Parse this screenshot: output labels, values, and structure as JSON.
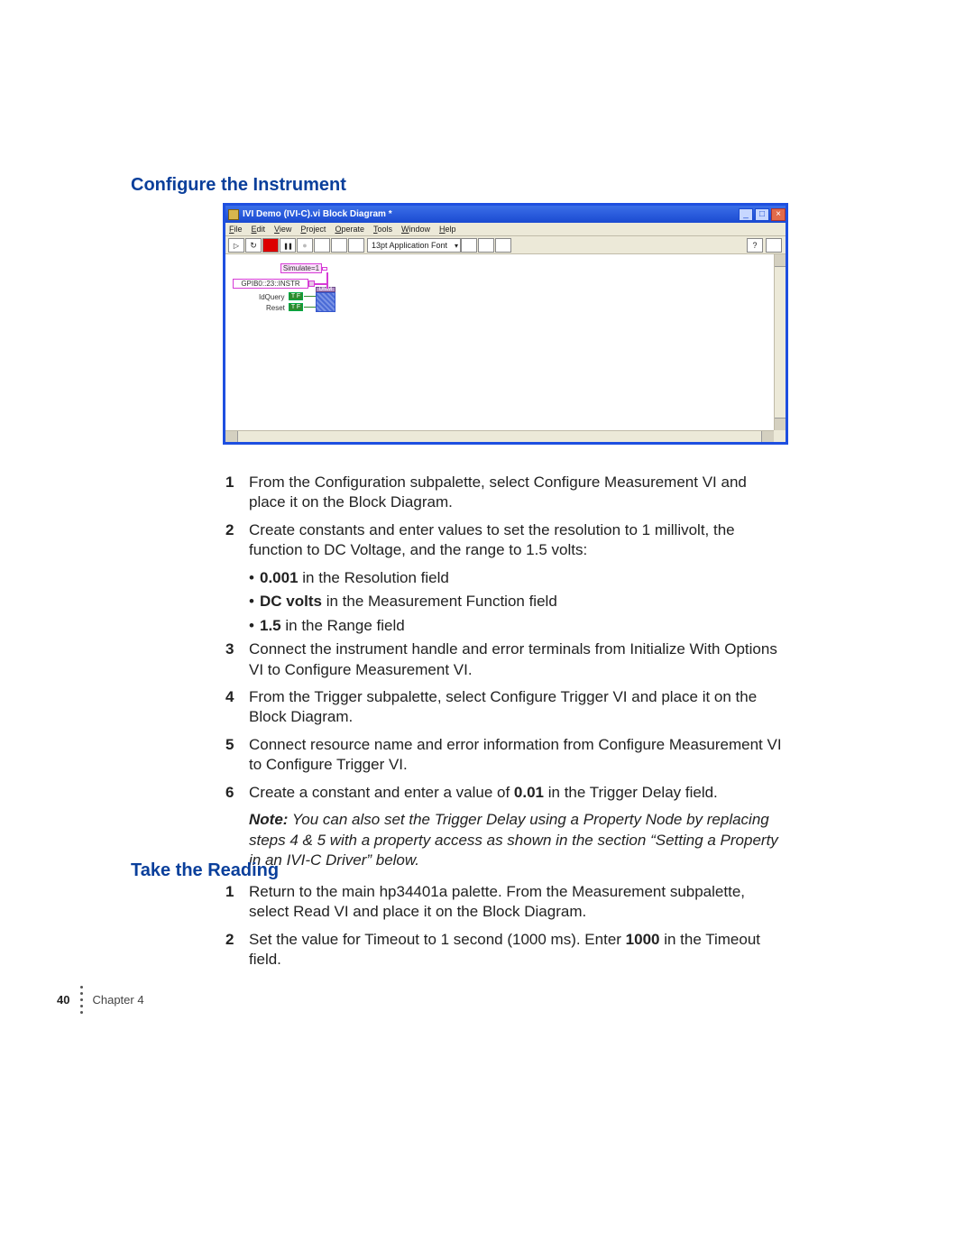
{
  "headings": {
    "configure": "Configure the Instrument",
    "take_reading": "Take the Reading"
  },
  "window": {
    "title": "IVI Demo (IVI-C).vi Block Diagram *",
    "menus": [
      "File",
      "Edit",
      "View",
      "Project",
      "Operate",
      "Tools",
      "Window",
      "Help"
    ],
    "font_label": "13pt Application Font",
    "nodes": {
      "simulate": "Simulate=1",
      "instr": "GPIB0::23::INSTR",
      "idquery": "IdQuery",
      "reset": "Reset",
      "bool_t": "T F",
      "vi_head": "DMM"
    }
  },
  "steps_configure": [
    {
      "n": "1",
      "t": "From the Configuration subpalette, select Configure Measurement VI and place it on the Block Diagram."
    },
    {
      "n": "2",
      "t": "Create constants and enter values to set the resolution to 1 millivolt, the function to DC Voltage, and the range to 1.5 volts:",
      "sub": [
        {
          "b": "0.001",
          "t": " in the Resolution field"
        },
        {
          "b": "DC volts",
          "t": " in the Measurement Function field"
        },
        {
          "b": "1.5",
          "t": " in the Range field"
        }
      ]
    },
    {
      "n": "3",
      "t": "Connect the instrument handle and error terminals from Initialize With Options VI to Configure Measurement VI."
    },
    {
      "n": "4",
      "t": "From the Trigger subpalette, select Configure Trigger VI and place it on the Block Diagram."
    },
    {
      "n": "5",
      "t": "Connect resource name and error information from Configure Measurement VI to Configure Trigger VI."
    },
    {
      "n": "6",
      "t_pre": "Create a constant and enter a value of ",
      "b": "0.01",
      "t_post": " in the Trigger Delay field.",
      "note_pre": "Note:",
      "note": " You can also set the Trigger Delay using a Property Node by replacing steps 4 & 5 with a property access as shown in the section “Setting a Property in an IVI-C Driver” below."
    }
  ],
  "steps_reading": [
    {
      "n": "1",
      "t": "Return to the main hp34401a palette. From the Measurement subpalette, select Read VI and place it on the Block Diagram."
    },
    {
      "n": "2",
      "t_pre": "Set the value for Timeout to 1 second (1000 ms). Enter ",
      "b": "1000",
      "t_post": " in the Timeout field."
    }
  ],
  "footer": {
    "page": "40",
    "chapter": "Chapter 4"
  }
}
